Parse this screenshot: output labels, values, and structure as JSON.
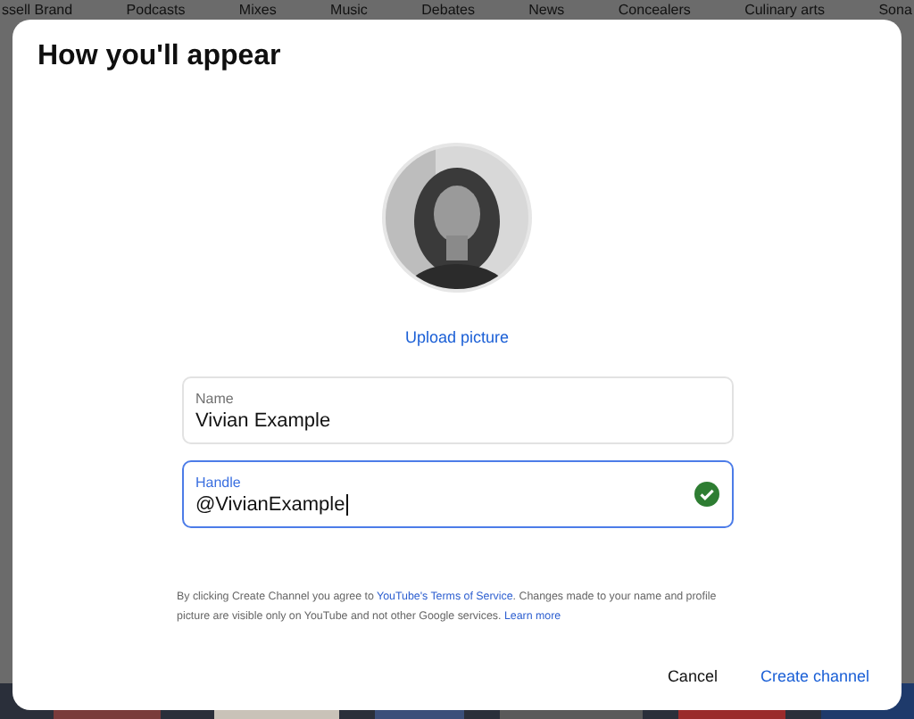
{
  "background": {
    "chips": [
      "ssell Brand",
      "Podcasts",
      "Mixes",
      "Music",
      "Debates",
      "News",
      "Concealers",
      "Culinary arts",
      "Sona"
    ]
  },
  "dialog": {
    "title": "How you'll appear",
    "upload_link": "Upload picture",
    "fields": [
      {
        "label": "Name",
        "value": "Vivian Example",
        "focused": false,
        "valid": false
      },
      {
        "label": "Handle",
        "value": "@VivianExample",
        "focused": true,
        "valid": true
      }
    ],
    "disclaimer_parts": [
      "By clicking Create Channel you agree to ",
      "YouTube's Terms of Service",
      ". Changes made to your name and profile picture are visible only on YouTube and not other Google services. ",
      "Learn more"
    ],
    "buttons": [
      {
        "label": "Cancel",
        "kind": "text"
      },
      {
        "label": "Create channel",
        "kind": "primary"
      }
    ]
  }
}
